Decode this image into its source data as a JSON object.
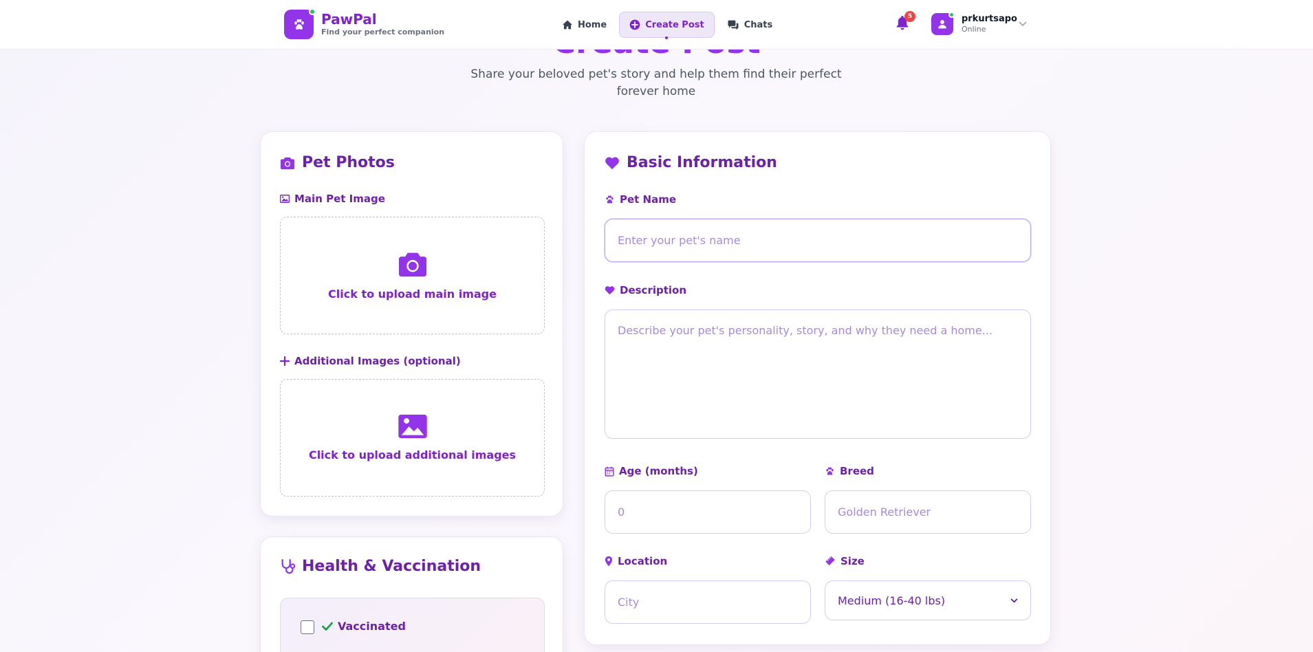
{
  "header": {
    "brand_name": "PawPal",
    "brand_tagline": "Find your perfect companion",
    "nav": [
      {
        "label": "Home",
        "icon": "home-icon",
        "active": false
      },
      {
        "label": "Create Post",
        "icon": "plus-circle-icon",
        "active": true
      },
      {
        "label": "Chats",
        "icon": "chat-icon",
        "active": false
      }
    ],
    "notification_count": "5",
    "user_name": "prkurtsapo",
    "user_status": "Online"
  },
  "hero": {
    "title": "Create Post",
    "subtitle": "Share your beloved pet's story and help them find their perfect forever home"
  },
  "photos": {
    "title": "Pet Photos",
    "main_label": "Main Pet Image",
    "main_upload": "Click to upload main image",
    "additional_label": "Additional Images (optional)",
    "additional_upload": "Click to upload additional images"
  },
  "health": {
    "title": "Health & Vaccination",
    "vaccinated_label": "Vaccinated",
    "vaccinated_checked": false
  },
  "basic": {
    "title": "Basic Information",
    "pet_name_label": "Pet Name",
    "pet_name_placeholder": "Enter your pet's name",
    "description_label": "Description",
    "description_placeholder": "Describe your pet's personality, story, and why they need a home...",
    "age_label": "Age (months)",
    "age_placeholder": "0",
    "breed_label": "Breed",
    "breed_placeholder": "Golden Retriever",
    "location_label": "Location",
    "location_placeholder": "City",
    "size_label": "Size",
    "size_value": "Medium (16-40 lbs)"
  },
  "colors": {
    "accent": "#9333ea",
    "heading": "#6b21a8",
    "online": "#22c55e",
    "badge": "#ef4444"
  }
}
